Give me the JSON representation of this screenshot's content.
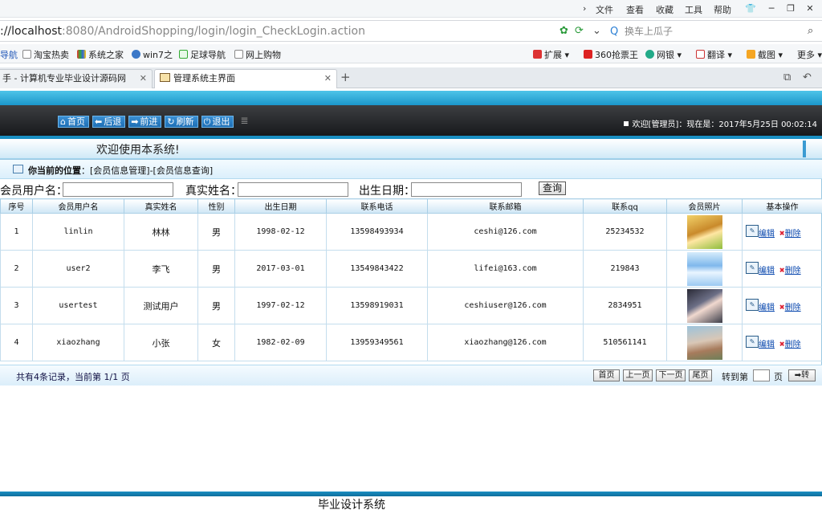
{
  "browser": {
    "menu": [
      "文件",
      "查看",
      "收藏",
      "工具",
      "帮助"
    ],
    "url_host": "://localhost",
    "url_rest": ":8080/AndroidShopping/login/login_CheckLogin.action",
    "search_placeholder": "换车上瓜子",
    "bookmarks": [
      "导航",
      "淘宝热卖",
      "系统之家",
      "win7之",
      "足球导航",
      "网上购物"
    ],
    "right_tools": [
      "扩展",
      "360抢票王",
      "网银",
      "翻译",
      "截图",
      "更多"
    ],
    "tabs": [
      {
        "label": "手 - 计算机专业毕业设计源码网"
      },
      {
        "label": "管理系统主界面"
      }
    ]
  },
  "app": {
    "nav": [
      {
        "label": "首页",
        "icon": "home-icon",
        "glyph": "⌂"
      },
      {
        "label": "后退",
        "icon": "back-arrow-icon",
        "glyph": "⬅"
      },
      {
        "label": "前进",
        "icon": "forward-arrow-icon",
        "glyph": "➡"
      },
      {
        "label": "刷新",
        "icon": "refresh-icon",
        "glyph": "↻"
      },
      {
        "label": "退出",
        "icon": "power-icon",
        "glyph": "⏻"
      }
    ],
    "welcome_text": "欢迎[管理员]",
    "now_label": "现在是：2017年5月25日 00:02:14",
    "banner": "欢迎使用本系统!",
    "crumb_label": "你当前的位置",
    "crumb_path": "：[会员信息管理]-[会员信息查询]",
    "filters": {
      "username_label": "会员用户名：",
      "realname_label": "真实姓名：",
      "birth_label": "出生日期：",
      "query_button": "查询"
    },
    "table": {
      "headers": [
        "序号",
        "会员用户名",
        "真实姓名",
        "性别",
        "出生日期",
        "联系电话",
        "联系邮箱",
        "联系qq",
        "会员照片",
        "基本操作"
      ],
      "rows": [
        {
          "no": "1",
          "username": "linlin",
          "realname": "林林",
          "gender": "男",
          "birth": "1998-02-12",
          "phone": "13598493934",
          "email": "ceshi@126.com",
          "qq": "25234532"
        },
        {
          "no": "2",
          "username": "user2",
          "realname": "李飞",
          "gender": "男",
          "birth": "2017-03-01",
          "phone": "13549843422",
          "email": "lifei@163.com",
          "qq": "219843"
        },
        {
          "no": "3",
          "username": "usertest",
          "realname": "测试用户",
          "gender": "男",
          "birth": "1997-02-12",
          "phone": "13598919031",
          "email": "ceshiuser@126.com",
          "qq": "2834951"
        },
        {
          "no": "4",
          "username": "xiaozhang",
          "realname": "小张",
          "gender": "女",
          "birth": "1982-02-09",
          "phone": "13959349561",
          "email": "xiaozhang@126.com",
          "qq": "510561141"
        }
      ],
      "edit_label": "编辑",
      "delete_label": "删除"
    },
    "pager": {
      "info": "共有4条记录，当前第 1/1 页",
      "first": "首页",
      "prev": "上一页",
      "next": "下一页",
      "last": "尾页",
      "goto_label": "转到第",
      "page_unit": "页",
      "go_button": "➡转"
    },
    "footer": "毕业设计系统"
  }
}
